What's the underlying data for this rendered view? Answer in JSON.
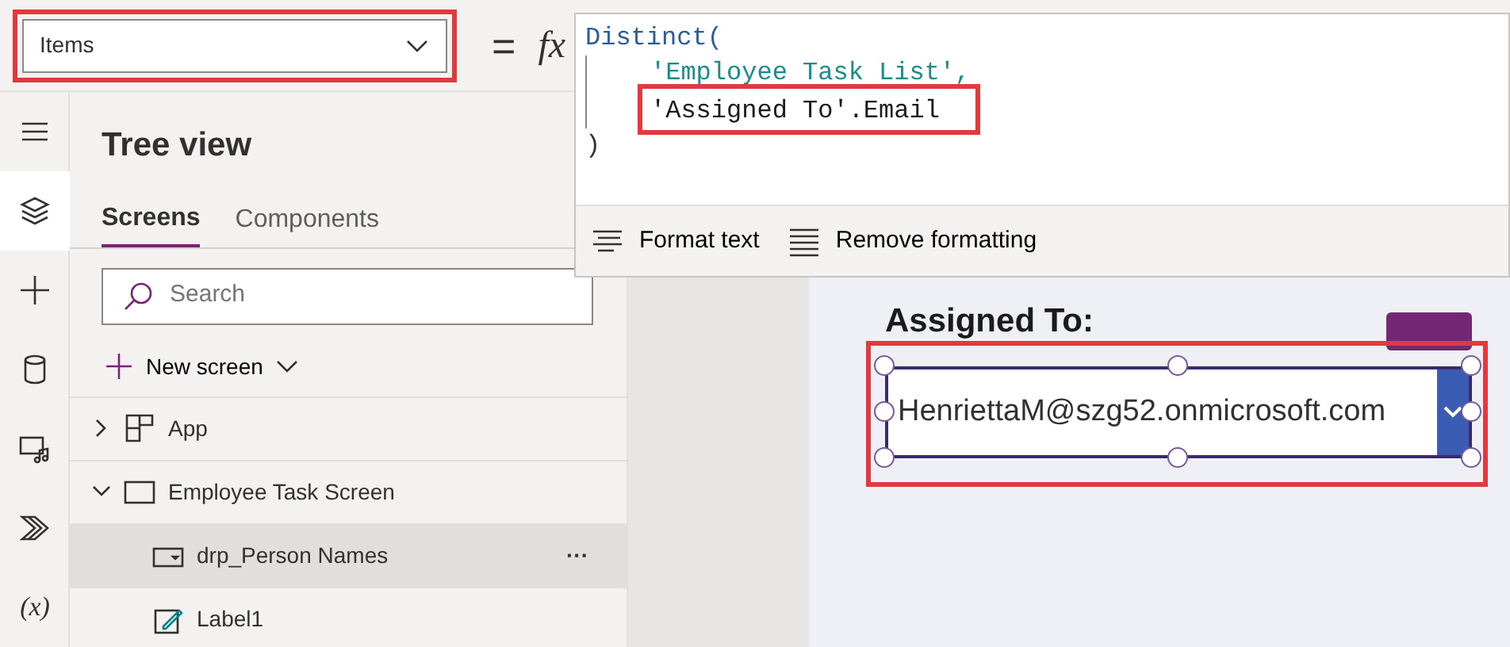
{
  "property_selector": {
    "value": "Items",
    "highlighted": true
  },
  "formula_bar": {
    "equals": "=",
    "fx": "fx",
    "lines": [
      {
        "text": "Distinct(",
        "kind": "function",
        "indent": false,
        "highlighted": false
      },
      {
        "text": "'Employee Task List',",
        "kind": "string",
        "indent": true,
        "highlighted": false
      },
      {
        "text": "'Assigned To'.Email",
        "kind": "field",
        "indent": true,
        "highlighted": true
      },
      {
        "text": ")",
        "kind": "punct",
        "indent": false,
        "highlighted": false
      }
    ],
    "toolbar": [
      {
        "label": "Format text",
        "kind": "format"
      },
      {
        "label": "Remove formatting",
        "kind": "remove"
      }
    ]
  },
  "rail": [
    {
      "kind": "menu",
      "selected": false
    },
    {
      "kind": "layers",
      "selected": true
    },
    {
      "kind": "plus",
      "selected": false
    },
    {
      "kind": "data",
      "selected": false
    },
    {
      "kind": "media",
      "selected": false
    },
    {
      "kind": "automate",
      "selected": false
    },
    {
      "kind": "variables",
      "glyph": "(x)",
      "selected": false
    }
  ],
  "tree_view": {
    "title": "Tree view",
    "tabs": [
      {
        "label": "Screens",
        "selected": true
      },
      {
        "label": "Components",
        "selected": false
      }
    ],
    "search": {
      "placeholder": "Search"
    },
    "new_screen": "New screen",
    "items": [
      {
        "label": "App",
        "kind": "app",
        "expanded": false,
        "selected": false
      },
      {
        "label": "Employee Task Screen",
        "kind": "screen",
        "expanded": true,
        "selected": false,
        "children": [
          {
            "label": "drp_Person Names",
            "kind": "dropdown",
            "selected": true,
            "more": "···"
          },
          {
            "label": "Label1",
            "kind": "label",
            "selected": false
          }
        ]
      }
    ]
  },
  "canvas": {
    "label": "Assigned To:",
    "dropdown": {
      "value": "HenriettaM@szg52.onmicrosoft.com",
      "selected": true,
      "highlighted": true
    }
  }
}
